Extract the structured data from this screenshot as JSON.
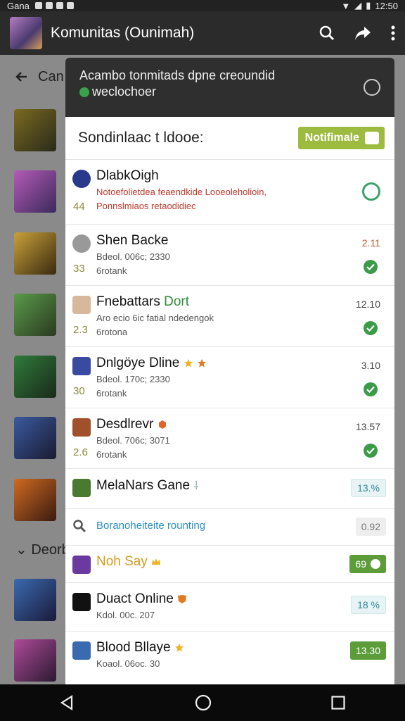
{
  "status_bar": {
    "left_text": "Gana",
    "right_text": "12:50"
  },
  "app_bar": {
    "title": "Komunitas (Ounimah)"
  },
  "background": {
    "header_text": "Can l",
    "section_text": "Deorb"
  },
  "dialog": {
    "header_text": "Acambo tonmitads dpne creoundid",
    "header_subtext": "weclochoer",
    "panel_title": "Sondinlaac t ldooe:",
    "notify_button": "Notifimale"
  },
  "rows": [
    {
      "name": "DlabkOigh",
      "sub1": "Notoefolietdea feaendkide Looeoleholioin,",
      "sub2": "Ponnslmiaos retaodidiec",
      "num": "44"
    },
    {
      "name": "Shen Backe",
      "sub1": "Bdeol. 006c; 2330",
      "sub2": "6rotank",
      "num": "33",
      "value": "2.11"
    },
    {
      "name": "Fnebattars",
      "name_suffix": "Dort",
      "sub1": "Aro ecio 6ic fatial ndedengok",
      "sub2": "6rotona",
      "num": "2.3",
      "value": "12.10"
    },
    {
      "name": "Dnlgöye Dline",
      "sub1": "Bdeol. 170c; 2330",
      "sub2": "6rotank",
      "num": "30",
      "value": "3.10"
    },
    {
      "name": "Desdlrevr",
      "sub1": "Bdeol. 706c; 3071",
      "sub2": "6rotank",
      "num": "2.6",
      "value": "13.57"
    },
    {
      "name": "MelaNars Gane",
      "pill": "13.%"
    },
    {
      "name": "Boranoheiteite rounting",
      "pill": "0.92"
    },
    {
      "name": "Noh Say",
      "pill": "69"
    },
    {
      "name": "Duact Online",
      "sub1": "Kdol. 00c. 207",
      "pill": "18 %"
    },
    {
      "name": "Blood Bllaye",
      "sub1": "Koaol. 06oc. 30",
      "pill": "13.30"
    }
  ]
}
